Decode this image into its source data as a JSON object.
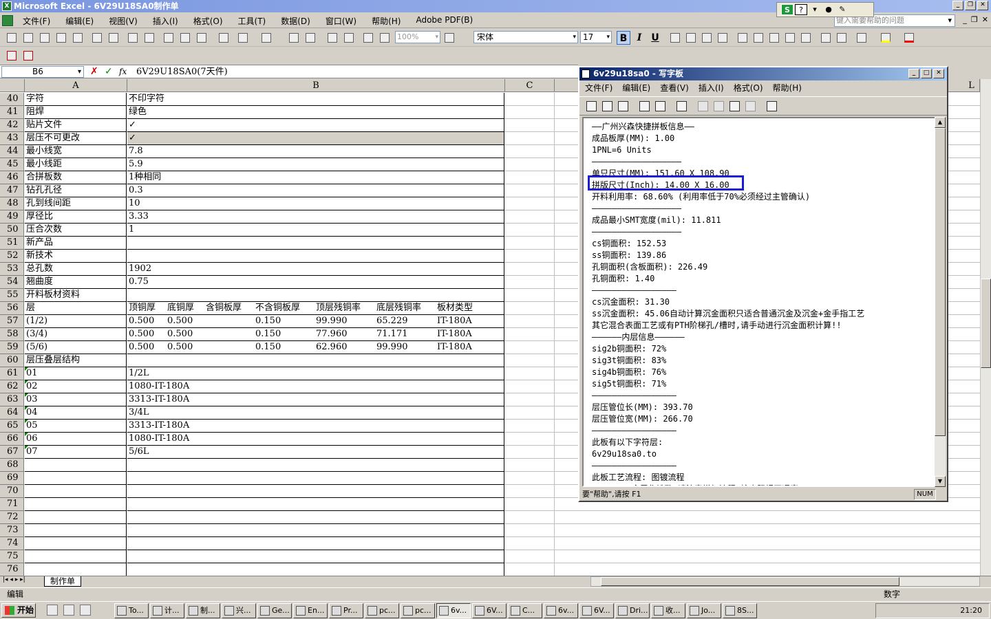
{
  "excel": {
    "title": "Microsoft Excel - 6V29U18SA0制作单",
    "menu": [
      "文件(F)",
      "编辑(E)",
      "视图(V)",
      "插入(I)",
      "格式(O)",
      "工具(T)",
      "数据(D)",
      "窗口(W)",
      "帮助(H)",
      "Adobe PDF(B)"
    ],
    "help_placeholder": "键入需要帮助的问题",
    "zoom": "100%",
    "font": "宋体",
    "font_size": "17",
    "bold_label": "B",
    "italic_label": "I",
    "underline_label": "U",
    "name_box": "B6",
    "formula": "6V29U18SA0(7天件)",
    "columns": [
      "A",
      "B",
      "C",
      "L"
    ],
    "rows": [
      {
        "n": "40",
        "a": "字符",
        "b": "不印字符"
      },
      {
        "n": "41",
        "a": "阻焊",
        "b": "绿色"
      },
      {
        "n": "42",
        "a": "贴片文件",
        "b": "✓"
      },
      {
        "n": "43",
        "a": "层压不可更改",
        "b": "✓"
      },
      {
        "n": "44",
        "a": "最小线宽",
        "b": "7.8"
      },
      {
        "n": "45",
        "a": "最小线距",
        "b": "5.9"
      },
      {
        "n": "46",
        "a": "合拼板数",
        "b": "1种相同"
      },
      {
        "n": "47",
        "a": "钻孔孔径",
        "b": "0.3"
      },
      {
        "n": "48",
        "a": "孔到线间距",
        "b": "10"
      },
      {
        "n": "49",
        "a": "厚径比",
        "b": "3.33"
      },
      {
        "n": "50",
        "a": "压合次数",
        "b": "1"
      },
      {
        "n": "51",
        "a": "新产品",
        "b": ""
      },
      {
        "n": "52",
        "a": "新技术",
        "b": ""
      },
      {
        "n": "53",
        "a": "总孔数",
        "b": "1902"
      },
      {
        "n": "54",
        "a": "翘曲度",
        "b": "0.75"
      },
      {
        "n": "55",
        "a": "开料板材资料",
        "b": ""
      }
    ],
    "layer_table": {
      "header": {
        "n": "56",
        "a": "层",
        "cols": [
          "顶铜厚",
          "底铜厚",
          "含铜板厚",
          "不含铜板厚",
          "顶层残铜率",
          "底层残铜率",
          "板材类型"
        ]
      },
      "rows": [
        {
          "n": "57",
          "a": "(1/2)",
          "cols": [
            "0.500",
            "0.500",
            "",
            "0.150",
            "99.990",
            "65.229",
            "IT-180A"
          ]
        },
        {
          "n": "58",
          "a": "(3/4)",
          "cols": [
            "0.500",
            "0.500",
            "",
            "0.150",
            "77.960",
            "71.171",
            "IT-180A"
          ]
        },
        {
          "n": "59",
          "a": "(5/6)",
          "cols": [
            "0.500",
            "0.500",
            "",
            "0.150",
            "62.960",
            "99.990",
            "IT-180A"
          ]
        }
      ]
    },
    "stack_rows": [
      {
        "n": "60",
        "a": "层压叠层结构",
        "b": ""
      },
      {
        "n": "61",
        "a": "01",
        "b": "1/2L"
      },
      {
        "n": "62",
        "a": "02",
        "b": "1080-IT-180A"
      },
      {
        "n": "63",
        "a": "03",
        "b": "3313-IT-180A"
      },
      {
        "n": "64",
        "a": "04",
        "b": "3/4L"
      },
      {
        "n": "65",
        "a": "05",
        "b": "3313-IT-180A"
      },
      {
        "n": "66",
        "a": "06",
        "b": "1080-IT-180A"
      },
      {
        "n": "67",
        "a": "07",
        "b": "5/6L"
      }
    ],
    "empty_rows": [
      "68",
      "69",
      "70",
      "71",
      "72",
      "73",
      "74",
      "75",
      "76"
    ],
    "sheet_tab": "制作单",
    "status_left": "编辑",
    "status_right": "数字"
  },
  "wordpad": {
    "title": "6v29u18sa0 - 写字板",
    "menu": [
      "文件(F)",
      "编辑(E)",
      "查看(V)",
      "插入(I)",
      "格式(O)",
      "帮助(H)"
    ],
    "lines": [
      "——广州兴森快捷拼板信息——",
      "成品板厚(MM): 1.00",
      "1PNL=6 Units",
      "——————————————————",
      "单只尺寸(MM): 151.60 X 108.90",
      "拼版尺寸(Inch): 14.00 X 16.00",
      "开料利用率: 68.60% (利用率低于70%必须经过主管确认)",
      "——————————————————",
      "成品最小SMT宽度(mil): 11.811",
      "——————————————————",
      "cs铜面积: 152.53",
      "ss铜面积: 139.86",
      "孔铜面积(含板面积): 226.49",
      "孔铜面积: 1.40",
      "—————————————————",
      "cs沉金面积: 31.30",
      "ss沉金面积: 45.06自动计算沉金面积只适合普通沉金及沉金+金手指工艺",
      "其它混合表面工艺或有PTH阶梯孔/槽时,请手动进行沉金面积计算!!",
      "——————内层信息——————",
      "sig2b铜面积: 72%",
      "sig3t铜面积: 83%",
      "sig4b铜面积: 76%",
      "sig5t铜面积: 71%",
      "—————————————————",
      "层压管位长(MM): 393.70",
      "层压管位宽(MM): 266.70",
      "—————————————————",
      "此板有以下字符层:",
      "6v29u18sa0.to",
      "—————————————————",
      "此板工艺流程: 图镀流程",
      "PTH/NPTH金属化铣孔,请注意增加流程,检查阻焊开通窗"
    ],
    "status": "要\"帮助\",请按 F1",
    "num": "NUM"
  },
  "taskbar": {
    "start": "开始",
    "tasks": [
      "To...",
      "计...",
      "制...",
      "兴...",
      "Ge...",
      "En...",
      "Pr...",
      "pc...",
      "pc...",
      "6v...",
      "6V...",
      "C...",
      "6v...",
      "6V...",
      "Dri...",
      "收...",
      "Jo...",
      "8S..."
    ],
    "clock": "21:20"
  }
}
